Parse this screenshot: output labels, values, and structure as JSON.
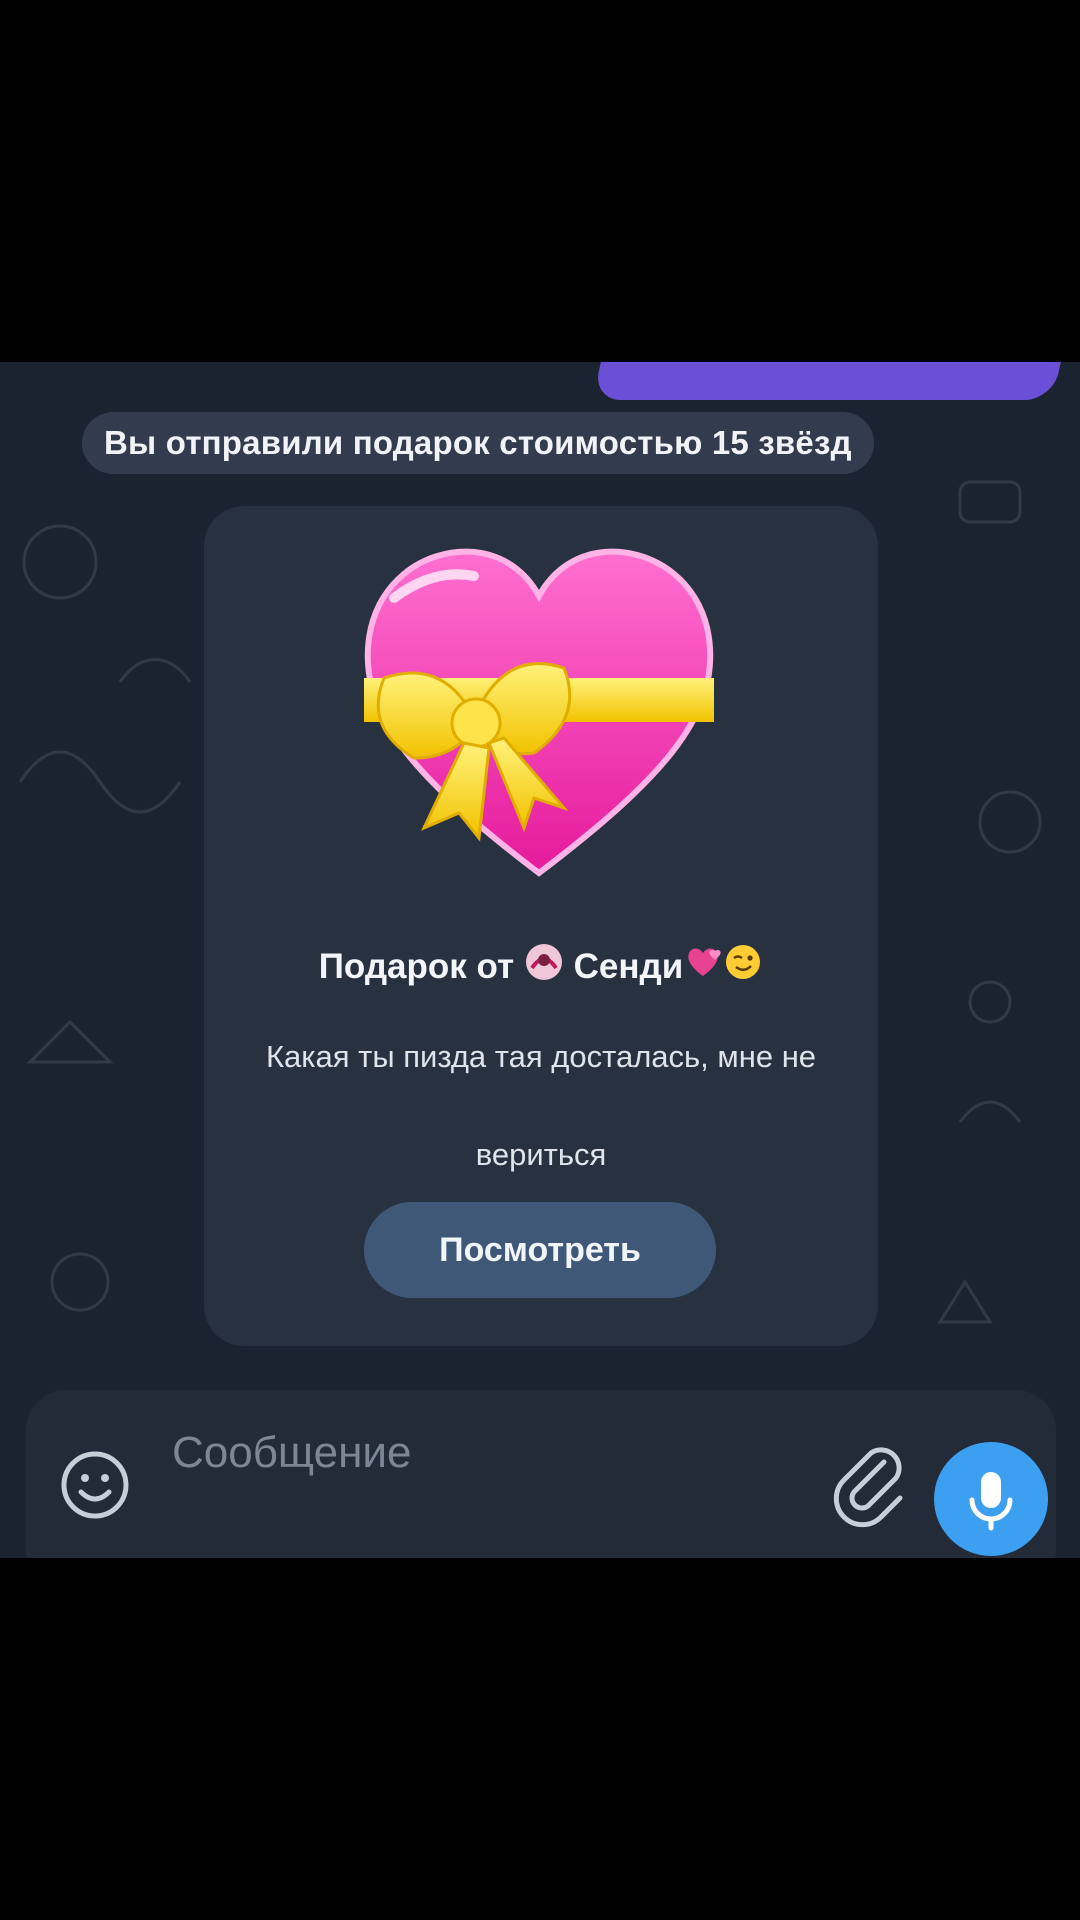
{
  "service_message": "Вы отправили подарок стоимостью 15 звёзд",
  "gift": {
    "title_prefix": "Подарок от",
    "sender_name": "Сенди",
    "message": "Какая ты пизда тая досталась, мне не вериться",
    "button_label": "Посмотреть",
    "icon": "pink-heart-with-ribbon"
  },
  "composer": {
    "placeholder": "Сообщение",
    "emoji_icon": "smiley-icon",
    "attach_icon": "paperclip-icon",
    "mic_icon": "microphone-icon"
  },
  "colors": {
    "chat_background": "#1b2230",
    "card_background": "#273140",
    "button_background": "#3f5877",
    "mic_button": "#3d9ff0",
    "outgoing_bubble": "#6b4fd6"
  }
}
